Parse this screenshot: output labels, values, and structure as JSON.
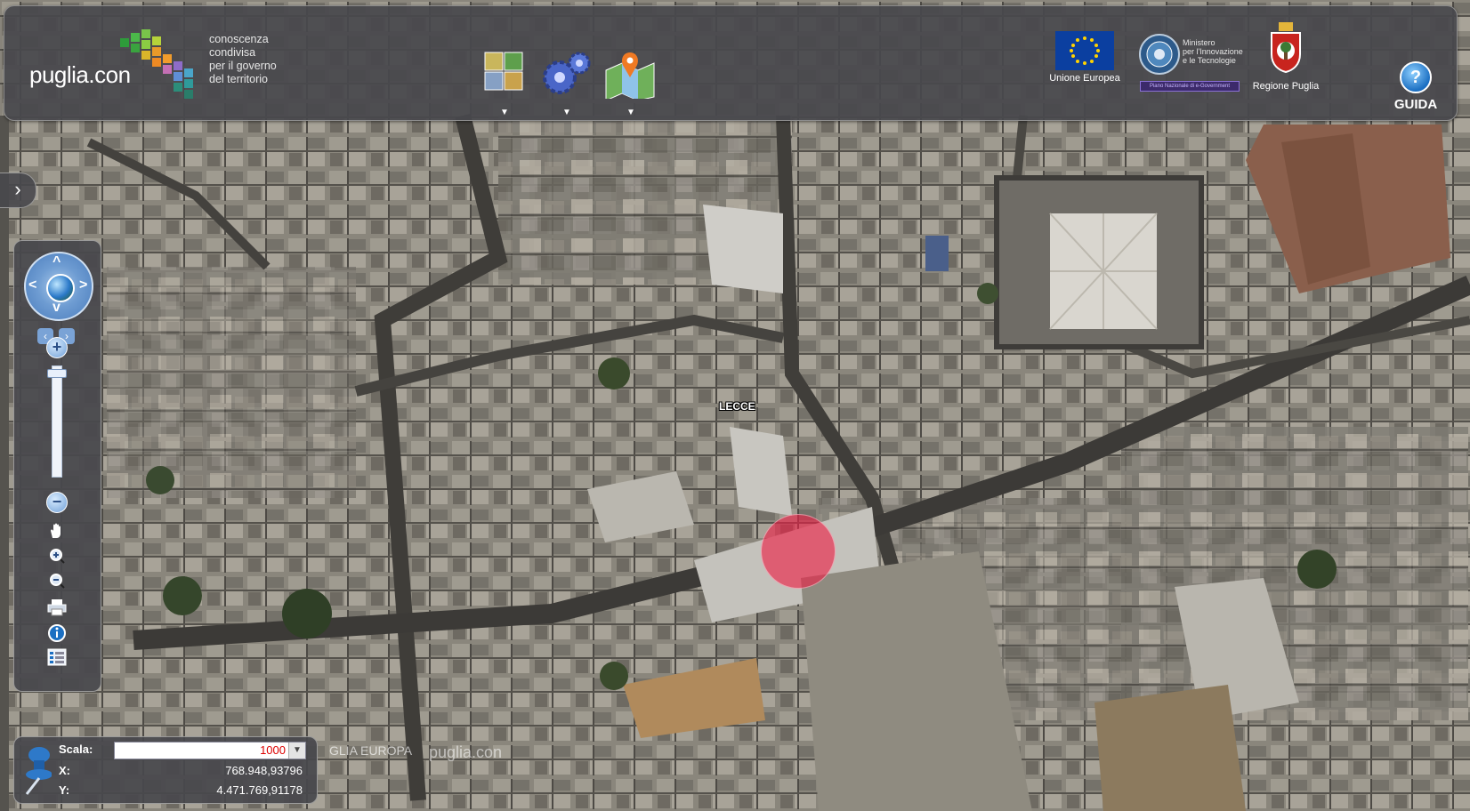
{
  "header": {
    "brand": {
      "name": "puglia.con",
      "tagline": [
        "conoscenza",
        "condivisa",
        "per il governo",
        "del territorio"
      ]
    },
    "tools": [
      {
        "icon": "layers-icon",
        "caret": "▼"
      },
      {
        "icon": "gears-icon",
        "caret": "▼"
      },
      {
        "icon": "map-pin-icon",
        "caret": "▼"
      }
    ],
    "logos": {
      "eu_label": "Unione Europea",
      "ministero": [
        "Ministero",
        "per l'Innovazione",
        "e le Tecnologie"
      ],
      "ministero_bar": "Piano Nazionale di e-Government",
      "puglia_label": "Regione Puglia"
    },
    "guida": {
      "icon": "help-icon",
      "glyph": "?",
      "label": "GUIDA"
    }
  },
  "side_toggle": {
    "icon": "chevron-right-icon",
    "glyph": "›"
  },
  "nav": {
    "compass_arrows": {
      "up": "^",
      "down": "v",
      "left": "<",
      "right": ">"
    },
    "rotate": {
      "left": "‹",
      "right": "›"
    },
    "zoom_in": "+",
    "zoom_out": "−",
    "tools": [
      "hand-pan-icon",
      "zoom-in-tool-icon",
      "zoom-out-tool-icon",
      "print-icon",
      "info-icon",
      "legend-icon"
    ]
  },
  "coords": {
    "scale_label": "Scala:",
    "scale_value": "1000",
    "x_label": "X:",
    "x_value": "768.948,93796",
    "y_label": "Y:",
    "y_value": "4.471.769,91178"
  },
  "map": {
    "place_label": "LECCE",
    "watermark_left": "GLIA EUROPA",
    "watermark_sub": "puglia.con"
  },
  "colors": {
    "panel": "#48484c",
    "marker": "#ee1e46",
    "accent_blue": "#1b6fc2"
  }
}
